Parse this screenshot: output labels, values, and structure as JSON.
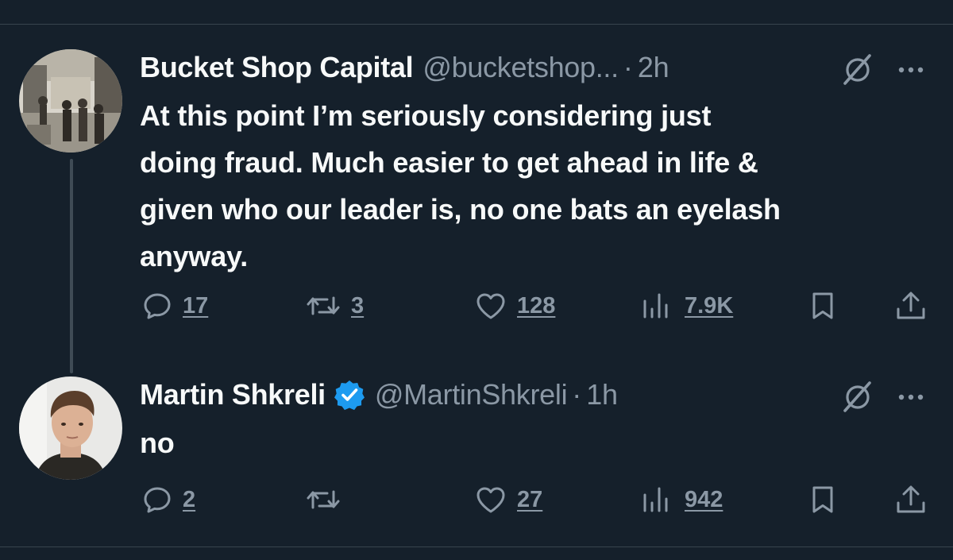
{
  "tweets": [
    {
      "author": "Bucket Shop Capital",
      "handle": "@bucketshop...",
      "separator": "·",
      "time": "2h",
      "verified": false,
      "text_lines": [
        "At this point I’m seriously considering just",
        "doing fraud.  Much easier to get ahead in life &",
        "given who our leader is, no one bats an eyelash",
        "anyway."
      ],
      "counts": {
        "replies": "17",
        "reposts": "3",
        "likes": "128",
        "views": "7.9K"
      }
    },
    {
      "author": "Martin Shkreli",
      "handle": "@MartinShkreli",
      "separator": "·",
      "time": "1h",
      "verified": true,
      "text_lines": [
        "no"
      ],
      "counts": {
        "replies": "2",
        "reposts": "",
        "likes": "27",
        "views": "942"
      }
    }
  ],
  "icons": {
    "reply": "reply-icon",
    "repost": "repost-icon",
    "like": "like-icon",
    "views": "views-icon",
    "bookmark": "bookmark-icon",
    "share": "share-icon",
    "grok": "grok-icon",
    "more": "more-icon",
    "verified": "verified-badge-icon"
  },
  "colors": {
    "background": "#15202b",
    "text": "#f7f9f9",
    "secondary": "#8b98a5",
    "verified": "#1d9bf0",
    "divider": "#38444d"
  }
}
